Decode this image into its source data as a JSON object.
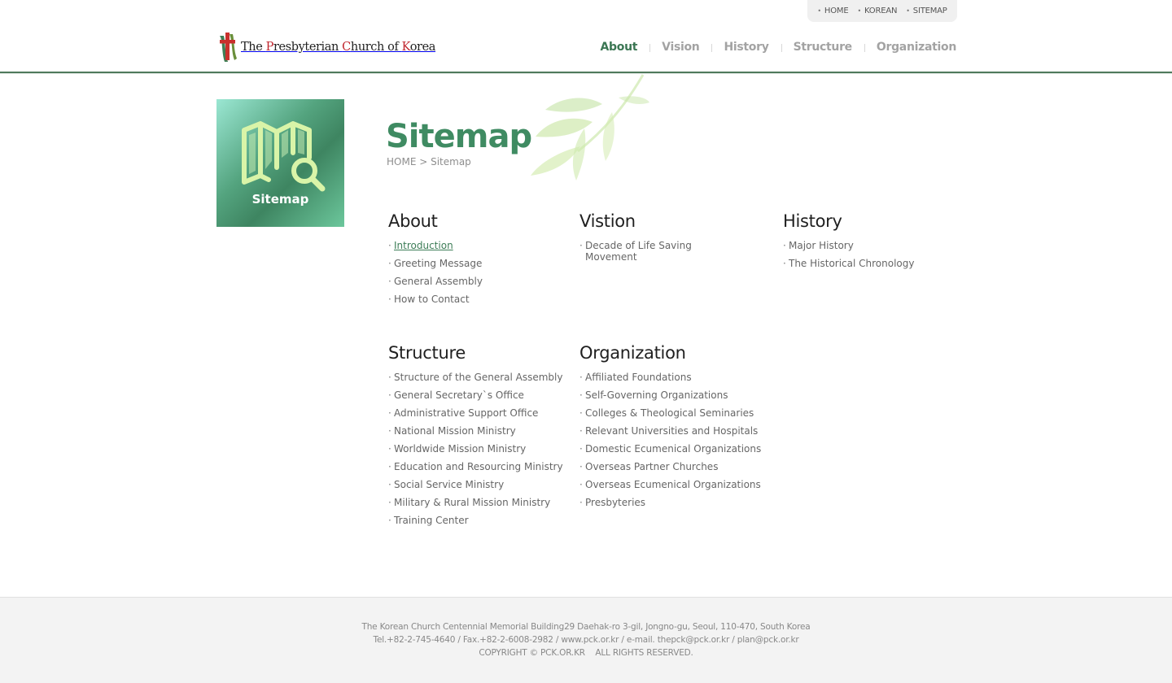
{
  "header": {
    "util_links": [
      {
        "label": "HOME"
      },
      {
        "label": "KOREAN"
      },
      {
        "label": "SITEMAP"
      }
    ],
    "logo": {
      "text_parts": [
        "The ",
        "P",
        "resbyterian ",
        "C",
        "hurch of ",
        "K",
        "orea"
      ]
    },
    "nav": [
      {
        "label": "About",
        "active": true
      },
      {
        "label": "Vision",
        "active": false
      },
      {
        "label": "History",
        "active": false
      },
      {
        "label": "Structure",
        "active": false
      },
      {
        "label": "Organization",
        "active": false
      }
    ]
  },
  "side": {
    "label": "Sitemap",
    "icon": "map-search-icon"
  },
  "title": {
    "heading": "Sitemap",
    "breadcrumb": "HOME > Sitemap"
  },
  "sitemap": {
    "about": {
      "title": "About",
      "items": [
        "Introduction",
        "Greeting Message",
        "General Assembly",
        "How to Contact"
      ]
    },
    "vision": {
      "title": "Vistion",
      "items": [
        "Decade of Life Saving Movement"
      ]
    },
    "history": {
      "title": "History",
      "items": [
        "Major History",
        "The Historical Chronology"
      ]
    },
    "structure": {
      "title": "Structure",
      "items": [
        "Structure of the General Assembly",
        "General Secretary`s Office",
        "Administrative Support Office",
        "National Mission Ministry",
        "Worldwide Mission Ministry",
        "Education and Resourcing Ministry",
        "Social Service Ministry",
        "Military & Rural Mission Ministry",
        "Training Center"
      ]
    },
    "organization": {
      "title": "Organization",
      "items": [
        "Affiliated Foundations",
        "Self-Governing Organizations",
        "Colleges & Theological Seminaries",
        "Relevant Universities and Hospitals",
        "Domestic Ecumenical Organizations",
        "Overseas Partner Churches",
        "Overseas Ecumenical Organizations",
        "Presbyteries"
      ]
    }
  },
  "footer": {
    "address": "The Korean Church Centennial Memorial Building29 Daehak-ro 3-gil, Jongno-gu, Seoul, 110-470, South Korea",
    "contact": "Tel.+82-2-745-4640 / Fax.+82-2-6008-2982 / www.pck.or.kr / e-mail. thepck@pck.or.kr / plan@pck.or.kr",
    "copyright": "COPYRIGHT © PCK.OR.KR    ALL RIGHTS RESERVED."
  },
  "colors": {
    "brand_green": "#3f8b62",
    "nav_active": "#3b7653",
    "logo_red": "#c0262e",
    "footer_bg": "#f3f3f3"
  }
}
